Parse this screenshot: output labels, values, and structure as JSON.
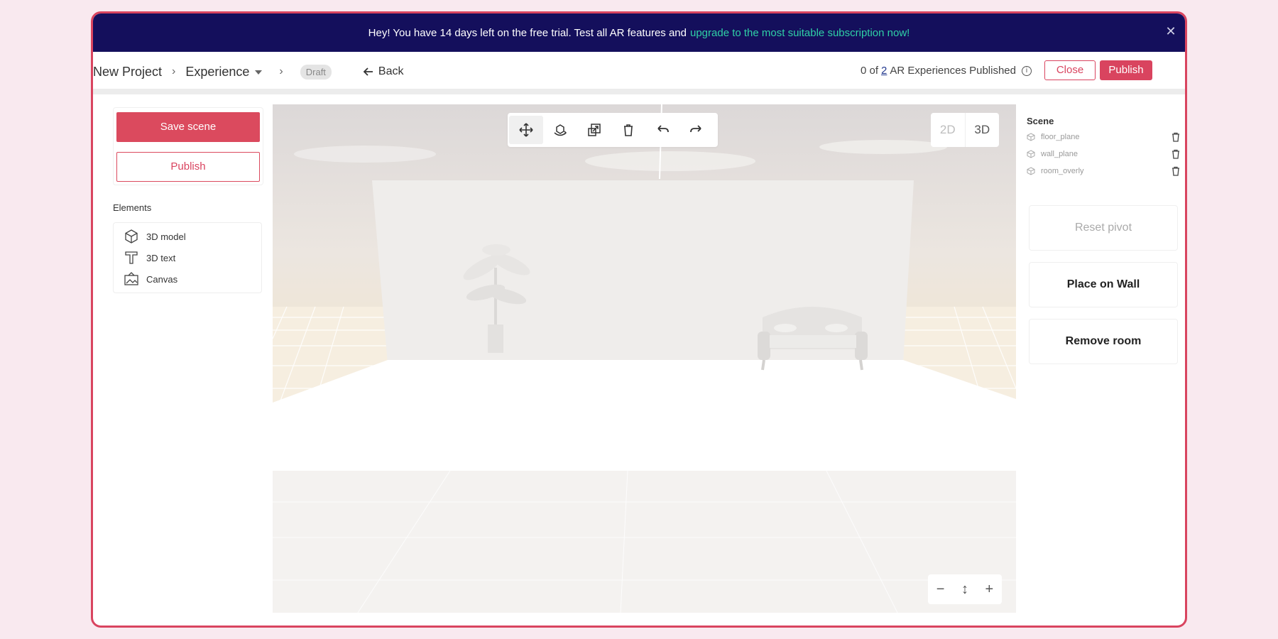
{
  "banner": {
    "text": "Hey! You have 14 days left on the free trial. Test all AR features and",
    "link": "upgrade to the most suitable subscription now!",
    "close_icon": "close-icon"
  },
  "breadcrumb": {
    "project": "New Project",
    "experience": "Experience",
    "status": "Draft",
    "back": "Back"
  },
  "publish_status": {
    "prefix": "0 of",
    "total": "2",
    "suffix": "AR Experiences Published"
  },
  "header_buttons": {
    "close": "Close",
    "publish": "Publish"
  },
  "left_panel": {
    "save": "Save scene",
    "publish": "Publish",
    "elements_heading": "Elements",
    "elements": [
      {
        "label": "3D model",
        "icon": "cube-icon"
      },
      {
        "label": "3D text",
        "icon": "text-t-icon"
      },
      {
        "label": "Canvas",
        "icon": "canvas-image-icon"
      }
    ]
  },
  "viewport": {
    "tools": [
      {
        "name": "move-tool",
        "icon": "move-arrows-icon"
      },
      {
        "name": "rotate-tool",
        "icon": "rotate-icon"
      },
      {
        "name": "scale-tool",
        "icon": "scale-icon"
      },
      {
        "name": "delete-tool",
        "icon": "trash-icon"
      },
      {
        "name": "undo-tool",
        "icon": "undo-icon"
      },
      {
        "name": "redo-tool",
        "icon": "redo-icon"
      }
    ],
    "dim_2d": "2D",
    "dim_3d": "3D",
    "zoom_out": "−",
    "zoom_fit": "↕",
    "zoom_in": "+"
  },
  "scene": {
    "heading": "Scene",
    "items": [
      "floor_plane",
      "wall_plane",
      "room_overly"
    ]
  },
  "right_panel": {
    "reset_pivot": "Reset pivot",
    "place_on_wall": "Place on Wall",
    "remove_room": "Remove room"
  },
  "colors": {
    "accent": "#d9445f",
    "banner_bg": "#140f5c",
    "banner_link": "#2fd0a6"
  }
}
